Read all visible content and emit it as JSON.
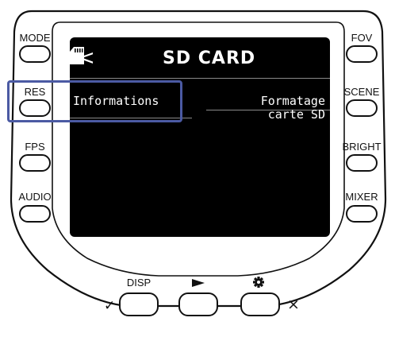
{
  "side_buttons_left": [
    {
      "label": "MODE"
    },
    {
      "label": "RES"
    },
    {
      "label": "FPS"
    },
    {
      "label": "AUDIO"
    }
  ],
  "side_buttons_right": [
    {
      "label": "FOV"
    },
    {
      "label": "SCENE"
    },
    {
      "label": "BRIGHT"
    },
    {
      "label": "MIXER"
    }
  ],
  "bottom_buttons": {
    "disp_label": "DISP",
    "play_icon": "play-triangle-icon",
    "settings_icon": "gear-icon",
    "confirm_mark": "✓",
    "cancel_mark": "×"
  },
  "screen": {
    "back_glyph": "<",
    "title": "SD CARD",
    "title_icon": "sd-card-icon",
    "menu_left": "Informations",
    "menu_right_line1": "Formatage",
    "menu_right_line2": "carte SD"
  },
  "colors": {
    "screen_bg": "#000000",
    "screen_text": "#ffffff",
    "highlight": "#4b5aa3"
  }
}
